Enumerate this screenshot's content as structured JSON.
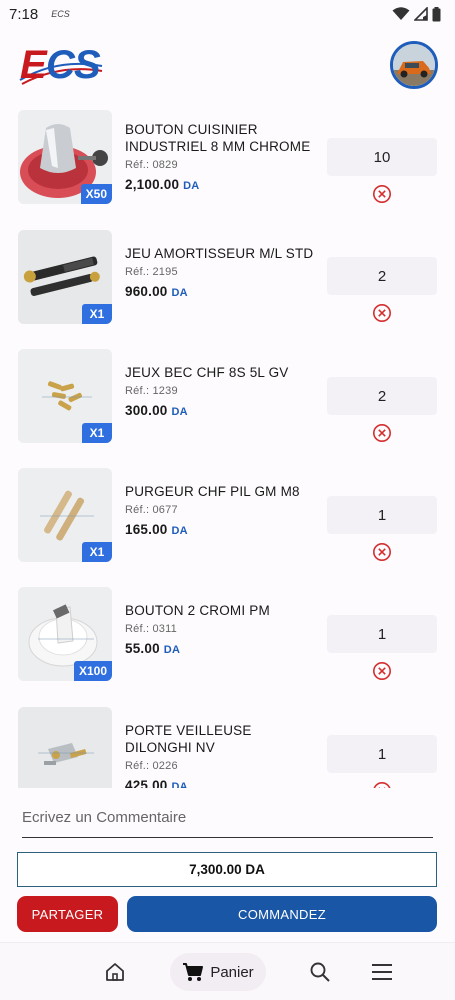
{
  "status_bar": {
    "time": "7:18",
    "notification": "ECS"
  },
  "header": {
    "logo_text": "ECS"
  },
  "cart": {
    "items": [
      {
        "name": "BOUTON CUISINIER INDUSTRIEL 8 MM CHROME",
        "ref": "Réf.: 0829",
        "price": "2,100.00",
        "currency": "DA",
        "badge": "X50",
        "quantity": "10",
        "image": "knob-chrome"
      },
      {
        "name": "JEU AMORTISSEUR M/L STD",
        "ref": "Réf.: 2195",
        "price": "960.00",
        "currency": "DA",
        "badge": "X1",
        "quantity": "2",
        "image": "shock-absorbers"
      },
      {
        "name": "JEUX BEC CHF 8S 5L GV",
        "ref": "Réf.: 1239",
        "price": "300.00",
        "currency": "DA",
        "badge": "X1",
        "quantity": "2",
        "image": "brass-nozzles"
      },
      {
        "name": "PURGEUR CHF PIL GM M8",
        "ref": "Réf.: 0677",
        "price": "165.00",
        "currency": "DA",
        "badge": "X1",
        "quantity": "1",
        "image": "brass-rods"
      },
      {
        "name": "BOUTON 2 CROMI PM",
        "ref": "Réf.: 0311",
        "price": "55.00",
        "currency": "DA",
        "badge": "X100",
        "quantity": "1",
        "image": "white-knob"
      },
      {
        "name": "PORTE VEILLEUSE DILONGHI NV",
        "ref": "Réf.: 0226",
        "price": "425.00",
        "currency": "DA",
        "badge": "",
        "quantity": "1",
        "image": "pilot-holder"
      }
    ]
  },
  "comment": {
    "placeholder": "Ecrivez un Commentaire"
  },
  "total": "7,300.00 DA",
  "actions": {
    "share_label": "PARTAGER",
    "order_label": "COMMANDEZ"
  },
  "bottom_nav": {
    "home_icon": "home-icon",
    "cart_label": "Panier",
    "search_icon": "search-icon",
    "menu_icon": "menu-icon"
  },
  "colors": {
    "accent_blue": "#1956a6",
    "accent_red": "#c8191e",
    "badge_blue": "#2f6fe0",
    "remove_red": "#d32f2f"
  }
}
